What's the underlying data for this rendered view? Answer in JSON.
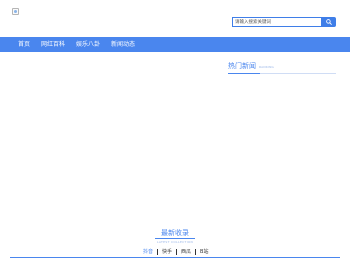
{
  "header": {
    "logo_icon": "broken-image-icon",
    "search": {
      "placeholder": "请输入搜索关键词",
      "button_icon": "search-icon"
    }
  },
  "nav": {
    "items": [
      {
        "label": "首页"
      },
      {
        "label": "网红百科"
      },
      {
        "label": "娱乐八卦"
      },
      {
        "label": "新闻动态"
      }
    ]
  },
  "hot_news": {
    "title": "热门新闻",
    "subtitle": "RANKING"
  },
  "latest": {
    "title": "最新收录",
    "subtitle": "LATEST COLLECTION",
    "tabs": [
      {
        "label": "抖音",
        "active": true
      },
      {
        "label": "快手",
        "active": false
      },
      {
        "label": "西瓜",
        "active": false
      },
      {
        "label": "B站",
        "active": false
      }
    ]
  },
  "colors": {
    "accent": "#4a86ee",
    "accent_light": "#9ab6e8"
  }
}
